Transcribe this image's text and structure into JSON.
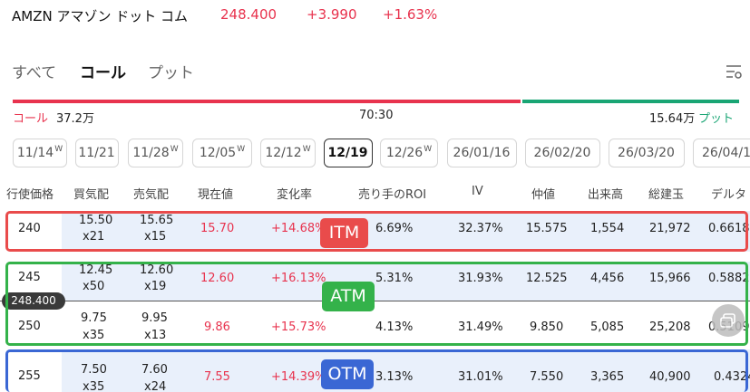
{
  "header": {
    "symbol": "AMZN アマゾン ドット コム",
    "price": "248.400",
    "change": "+3.990",
    "change_pct": "+1.63%"
  },
  "tabs": {
    "all": "すべて",
    "call": "コール",
    "put": "プット",
    "active": "コール"
  },
  "ratio": {
    "call_label": "コール",
    "call_value": "37.2万",
    "ratio": "70:30",
    "put_value": "15.64万",
    "put_label": "プット",
    "call_fraction": 0.7
  },
  "expiries": [
    {
      "label": "11/14",
      "sup": "W"
    },
    {
      "label": "11/21",
      "sup": ""
    },
    {
      "label": "11/28",
      "sup": "W"
    },
    {
      "label": "12/05",
      "sup": "W"
    },
    {
      "label": "12/12",
      "sup": "W"
    },
    {
      "label": "12/19",
      "sup": ""
    },
    {
      "label": "12/26",
      "sup": "W"
    },
    {
      "label": "26/01/16",
      "sup": ""
    },
    {
      "label": "26/02/20",
      "sup": ""
    },
    {
      "label": "26/03/20",
      "sup": ""
    },
    {
      "label": "26/04/1",
      "sup": ""
    }
  ],
  "selected_expiry": "12/19",
  "columns": {
    "strike": "行使価格",
    "bid": "買気配",
    "ask": "売気配",
    "last": "現在値",
    "change": "変化率",
    "roi": "売り手のROI",
    "iv": "IV",
    "mid": "仲値",
    "volume": "出来高",
    "oi": "総建玉",
    "delta": "デルタ"
  },
  "rows": [
    {
      "strike": "240",
      "bid": "15.50",
      "bid_size": "x21",
      "ask": "15.65",
      "ask_size": "x15",
      "last": "15.70",
      "change": "+14.68%",
      "roi": "6.69%",
      "iv": "32.37%",
      "mid": "15.575",
      "volume": "1,554",
      "oi": "21,972",
      "delta": "0.6618"
    },
    {
      "strike": "245",
      "bid": "12.45",
      "bid_size": "x50",
      "ask": "12.60",
      "ask_size": "x19",
      "last": "12.60",
      "change": "+16.13%",
      "roi": "5.31%",
      "iv": "31.93%",
      "mid": "12.525",
      "volume": "4,456",
      "oi": "15,966",
      "delta": "0.5882"
    },
    {
      "strike": "250",
      "bid": "9.75",
      "bid_size": "x35",
      "ask": "9.95",
      "ask_size": "x13",
      "last": "9.86",
      "change": "+15.73%",
      "roi": "4.13%",
      "iv": "31.49%",
      "mid": "9.850",
      "volume": "5,085",
      "oi": "25,208",
      "delta": "0.5109"
    },
    {
      "strike": "255",
      "bid": "7.50",
      "bid_size": "x35",
      "ask": "7.60",
      "ask_size": "x24",
      "last": "7.55",
      "change": "+14.39%",
      "roi": "3.13%",
      "iv": "31.01%",
      "mid": "7.550",
      "volume": "3,365",
      "oi": "40,900",
      "delta": "0.4324"
    }
  ],
  "underlying_marker": "248.400",
  "annotations": {
    "itm": "ITM",
    "atm": "ATM",
    "otm": "OTM"
  },
  "colors": {
    "up": "#e8334e",
    "put": "#19a574",
    "itm": "#e94b4b",
    "atm": "#34b24a",
    "otm": "#3a67d4",
    "itm_shade": "#e9f0fb"
  }
}
